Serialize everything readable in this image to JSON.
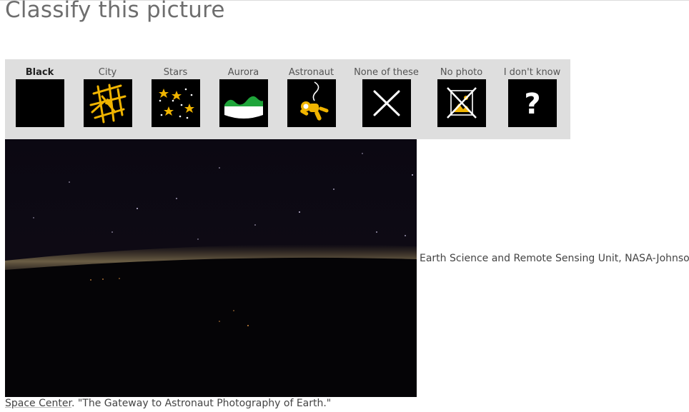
{
  "page": {
    "title": "Classify this picture"
  },
  "choices": [
    {
      "label": "Black",
      "icon": "black-square-icon",
      "selected": true
    },
    {
      "label": "City",
      "icon": "city-map-icon"
    },
    {
      "label": "Stars",
      "icon": "stars-icon"
    },
    {
      "label": "Aurora",
      "icon": "aurora-icon"
    },
    {
      "label": "Astronaut",
      "icon": "astronaut-icon"
    },
    {
      "label": "None of these",
      "icon": "x-icon"
    },
    {
      "label": "No photo",
      "icon": "no-photo-icon"
    },
    {
      "label": "I don't know",
      "icon": "question-mark-icon"
    }
  ],
  "credit": {
    "line1": "Earth Science and Remote Sensing Unit, NASA-Johnson",
    "line2_link": "Space Center",
    "line2_rest": ". \"The Gateway to Astronaut Photography of Earth.\""
  },
  "colors": {
    "panel_bg": "#dedede",
    "icon_accent": "#f0b400",
    "aurora_green": "#1fa53a"
  }
}
